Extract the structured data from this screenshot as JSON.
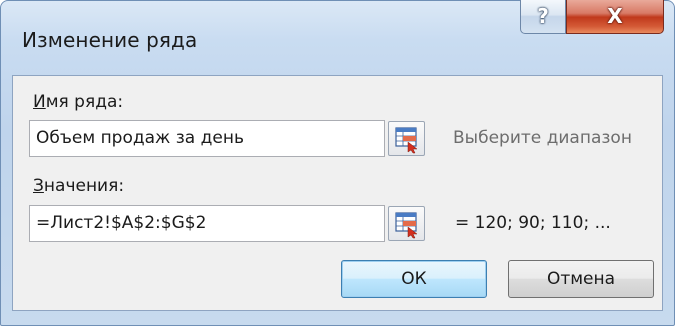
{
  "window": {
    "title": "Изменение ряда",
    "help_glyph": "?",
    "close_glyph": "X"
  },
  "series_name": {
    "label_accel": "И",
    "label_rest": "мя ряда:",
    "value": "Объем продаж за день",
    "hint": "Выберите диапазон",
    "range_button_icon": "range-select-icon"
  },
  "series_values": {
    "label_accel": "З",
    "label_rest": "начения:",
    "value": "=Лист2!$A$2:$G$2",
    "preview": "= 120; 90; 110; ...",
    "range_button_icon": "range-select-icon"
  },
  "buttons": {
    "ok_label": "ОК",
    "cancel_label": "Отмена"
  },
  "colors": {
    "close_button": "#c0391c",
    "default_button_border": "#3c7fb1",
    "frame_border": "#6f8fb5"
  }
}
